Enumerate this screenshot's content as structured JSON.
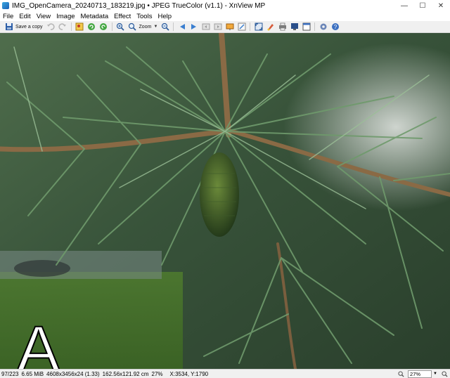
{
  "window": {
    "title": "IMG_OpenCamera_20240713_183219.jpg • JPEG TrueColor (v1.1) - XnView MP",
    "minimize": "—",
    "maximize": "☐",
    "close": "✕"
  },
  "menu": [
    "File",
    "Edit",
    "View",
    "Image",
    "Metadata",
    "Effect",
    "Tools",
    "Help"
  ],
  "toolbar": {
    "save_copy_label": "Save a copy",
    "zoom_label": "Zoom"
  },
  "overlay": {
    "letter": "A"
  },
  "status": {
    "index": "97/223",
    "filesize": "6.65 MiB",
    "dimensions": "4608x3456x24 (1.33)",
    "print_size": "162.56x121.92 cm",
    "zoom_percent": "27%",
    "coords": "X:3534, Y:1790",
    "zoom_field": "27%"
  },
  "colors": {
    "titlebar_bg": "#ffffff",
    "toolbar_bg": "#f0f0f0",
    "needle_green": "#5d8a5a",
    "branch_brown": "#8a6a45"
  }
}
